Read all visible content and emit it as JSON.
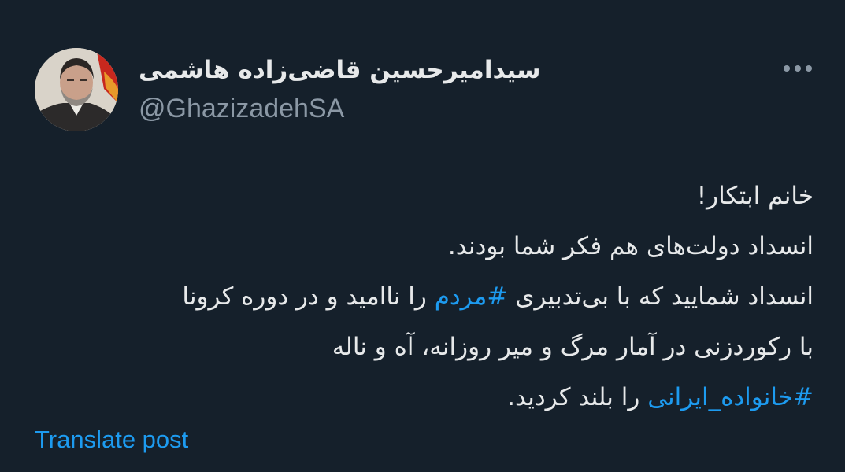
{
  "author": {
    "display_name": "سیدامیرحسین قاضی‌زاده هاشمی",
    "handle": "@GhazizadehSA",
    "avatar_icon": "profile-photo"
  },
  "more_icon": "more-options-icon",
  "tweet": {
    "line1": "خانم ابتکار!",
    "line2": "انسداد دولت‌های هم فکر شما بودند.",
    "line3_before": "انسداد شمایید که با بی‌تدبیری ",
    "line3_hashtag": "#مردم",
    "line3_after": " را ناامید و در دوره کرونا",
    "line4": "با رکوردزنی در آمار مرگ و میر روزانه، آه و ناله",
    "line5_hashtag": "#خانواده_ایرانی",
    "line5_after": " را بلند کردید."
  },
  "translate_label": "Translate post",
  "colors": {
    "background": "#15202b",
    "text": "#e7e9ea",
    "secondary_text": "#8b98a5",
    "link": "#1d9bf0"
  }
}
